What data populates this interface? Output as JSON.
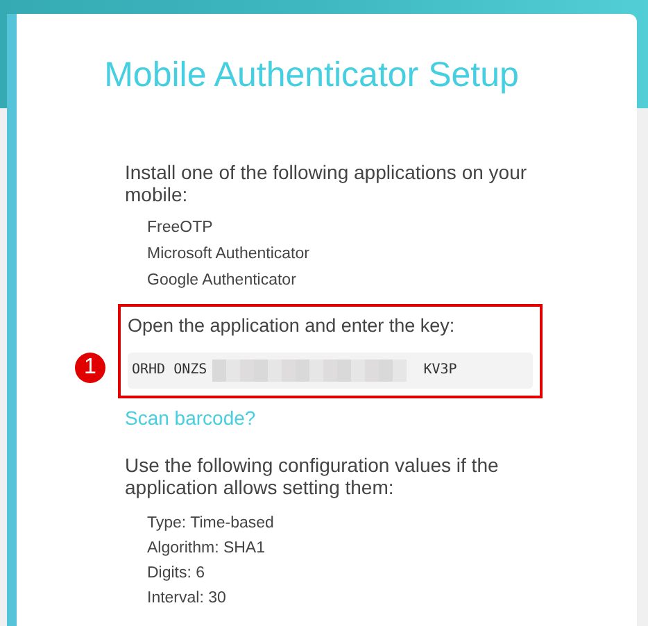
{
  "title": "Mobile Authenticator Setup",
  "install_text": "Install one of the following applications on your mobile:",
  "apps": [
    "FreeOTP",
    "Microsoft Authenticator",
    "Google Authenticator"
  ],
  "key_step": {
    "text": "Open the application and enter the key:",
    "key_start": "ORHD ONZS",
    "key_end": "KV3P",
    "callout": "1"
  },
  "scan_link": "Scan barcode?",
  "config_text": "Use the following configuration values if the application allows setting them:",
  "config": [
    "Type: Time-based",
    "Algorithm: SHA1",
    "Digits: 6",
    "Interval: 30"
  ]
}
